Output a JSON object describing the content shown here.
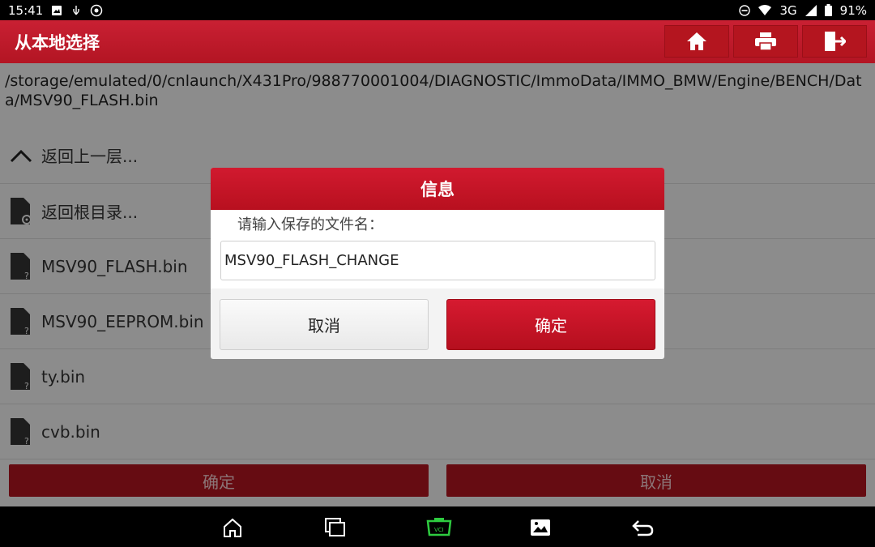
{
  "status_bar": {
    "time": "15:41",
    "network": "3G",
    "battery": "91%"
  },
  "header": {
    "title": "从本地选择"
  },
  "path": "/storage/emulated/0/cnlaunch/X431Pro/988770001004/DIAGNOSTIC/ImmoData/IMMO_BMW/Engine/BENCH/Data/MSV90_FLASH.bin",
  "file_list": [
    {
      "label": "返回上一层...",
      "icon": "chevron-up-icon"
    },
    {
      "label": "返回根目录...",
      "icon": "folder-settings-icon"
    },
    {
      "label": "MSV90_FLASH.bin",
      "icon": "file-unknown-icon"
    },
    {
      "label": "MSV90_EEPROM.bin",
      "icon": "file-unknown-icon"
    },
    {
      "label": "ty.bin",
      "icon": "file-unknown-icon"
    },
    {
      "label": "cvb.bin",
      "icon": "file-unknown-icon"
    }
  ],
  "bottom_actions": {
    "confirm_label": "确定",
    "cancel_label": "取消"
  },
  "dialog": {
    "title": "信息",
    "prompt": "请输入保存的文件名：",
    "input_value": "MSV90_FLASH_CHANGE",
    "cancel_label": "取消",
    "ok_label": "确定"
  },
  "colors": {
    "brand_red": "#c41a2c",
    "dialog_ok_red": "#c8142a"
  }
}
